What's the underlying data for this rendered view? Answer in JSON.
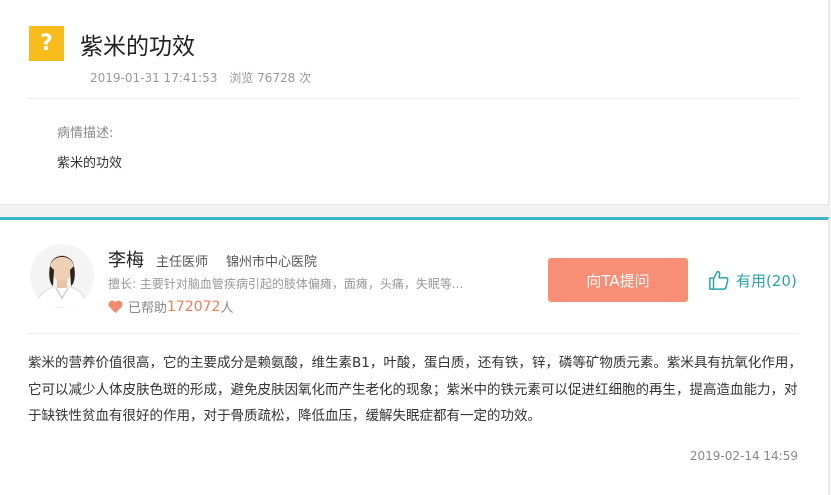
{
  "question": {
    "badge": "?",
    "title": "紫米的功效",
    "datetime": "2019-01-31 17:41:53",
    "views_label": "浏览 76728 次",
    "desc_label": "病情描述:",
    "desc_text": "紫米的功效"
  },
  "doctor": {
    "name": "李梅",
    "title": "主任医师",
    "hospital": "锦州市中心医院",
    "specialty": "擅长: 主要针对脑血管疾病引起的肢体偏瘫，面瘫，头痛，失眠等...",
    "helped_prefix": "已帮助",
    "helped_count": "172072",
    "helped_suffix": "人"
  },
  "actions": {
    "ask_label": "向TA提问",
    "useful_label": "有用(20)"
  },
  "answer": {
    "text": "紫米的营养价值很高，它的主要成分是赖氨酸，维生素B1，叶酸，蛋白质，还有铁，锌，磷等矿物质元素。紫米具有抗氧化作用，它可以减少人体皮肤色斑的形成，避免皮肤因氧化而产生老化的现象；紫米中的铁元素可以促进红细胞的再生，提高造血能力，对于缺铁性贫血有很好的作用，对于骨质疏松，降低血压，缓解失眠症都有一定的功效。",
    "date": "2019-02-14 14:59"
  },
  "colors": {
    "badge": "#f8bb1c",
    "accent_border": "#3db6c7",
    "ask_button": "#f88e76",
    "useful": "#2aa3a8",
    "helped_count": "#f07c5c"
  },
  "icons": [
    "question-badge-icon",
    "heart-icon",
    "thumbs-up-icon",
    "doctor-avatar"
  ]
}
